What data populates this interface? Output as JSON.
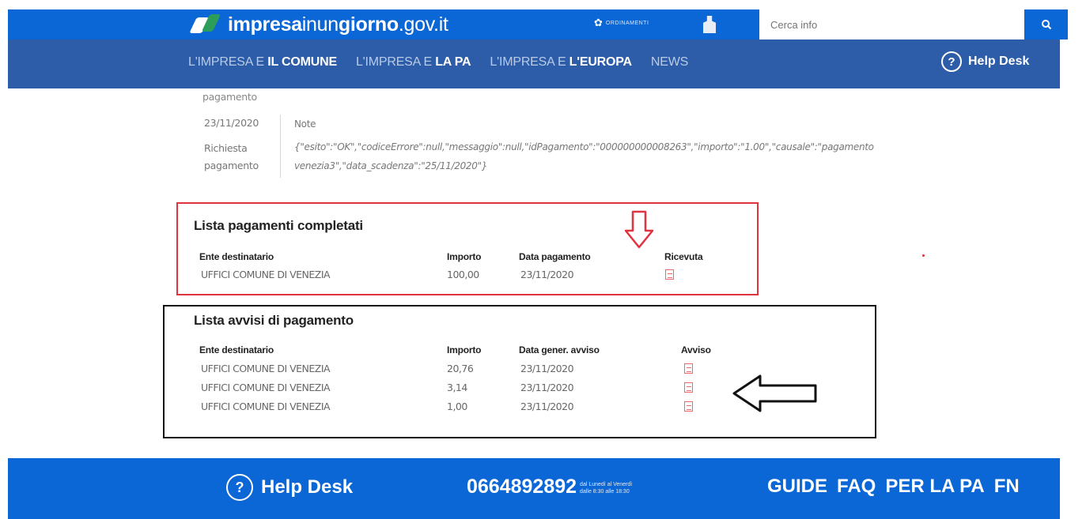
{
  "header": {
    "logo_bold": "impresa",
    "logo_thin": "inun",
    "logo_bold2": "giorno",
    "logo_domain": ".gov.it",
    "gov_label": "ORDINAMENTI",
    "search_placeholder": "Cerca info",
    "icons": {
      "search": "search-icon",
      "gov": "gov-emblem-icon"
    }
  },
  "nav": {
    "items": [
      {
        "prefix": "L'IMPRESA E ",
        "bold": "IL COMUNE"
      },
      {
        "prefix": "L'IMPRESA E ",
        "bold": "LA PA"
      },
      {
        "prefix": "L'IMPRESA E ",
        "bold": "L'EUROPA"
      },
      {
        "prefix": "NEWS",
        "bold": ""
      }
    ],
    "helpdesk": "Help Desk",
    "helpdesk_icon": "?"
  },
  "note": {
    "cut_label": "pagamento",
    "date": "23/11/2020",
    "label_line1": "Richiesta",
    "label_line2": "pagamento",
    "title": "Note",
    "body": "{\"esito\":\"OK\",\"codiceErrore\":null,\"messaggio\":null,\"idPagamento\":\"000000000008263\",\"importo\":\"1.00\",\"causale\":\"pagamento venezia3\",\"data_scadenza\":\"25/11/2020\"}"
  },
  "completed": {
    "title": "Lista pagamenti completati",
    "headers": [
      "Ente destinatario",
      "Importo",
      "Data pagamento",
      "Ricevuta"
    ],
    "rows": [
      {
        "ente": "UFFICI COMUNE DI VENEZIA",
        "importo": "100,00",
        "data": "23/11/2020"
      }
    ]
  },
  "notices": {
    "title": "Lista avvisi di pagamento",
    "headers": [
      "Ente destinatario",
      "Importo",
      "Data gener. avviso",
      "Avviso"
    ],
    "rows": [
      {
        "ente": "UFFICI COMUNE DI VENEZIA",
        "importo": "20,76",
        "data": "23/11/2020"
      },
      {
        "ente": "UFFICI COMUNE DI VENEZIA",
        "importo": "3,14",
        "data": "23/11/2020"
      },
      {
        "ente": "UFFICI COMUNE DI VENEZIA",
        "importo": "1,00",
        "data": "23/11/2020"
      }
    ]
  },
  "footer": {
    "helpdesk": "Help Desk",
    "helpdesk_icon": "?",
    "phone": "0664892892",
    "hours_line1": "dal Lunedì al Venerdì",
    "hours_line2": "dalle 8:30 alle 18:30",
    "links": [
      "GUIDE",
      "FAQ",
      "PER LA PA",
      "FN"
    ]
  },
  "colors": {
    "header_blue": "#0b66d6",
    "nav_blue": "#2d5da8",
    "highlight_red": "#e0333f",
    "highlight_black": "#111111"
  }
}
